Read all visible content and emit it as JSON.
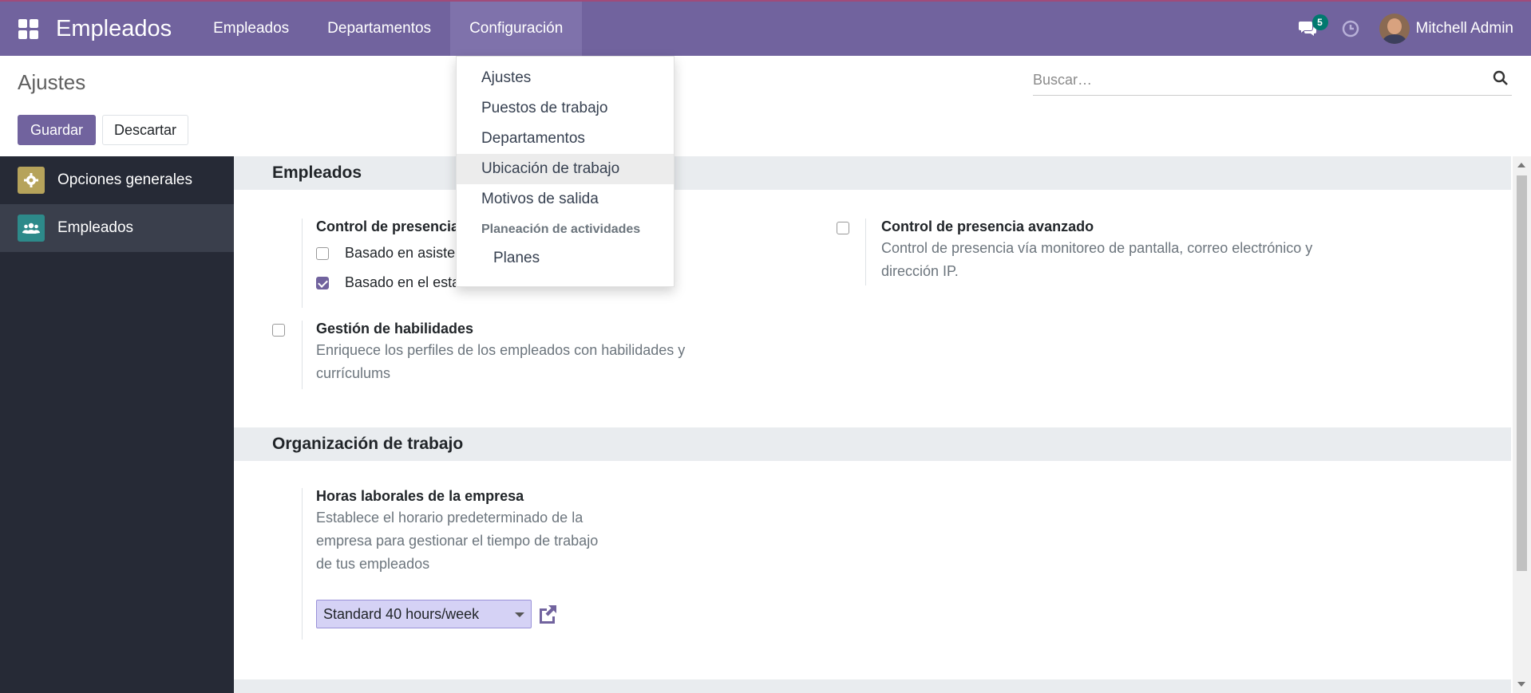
{
  "app": {
    "brand": "Empleados",
    "menu": [
      "Empleados",
      "Departamentos",
      "Configuración"
    ],
    "active_menu": "Configuración",
    "chat_badge": "5",
    "user": "Mitchell Admin"
  },
  "control": {
    "title": "Ajustes",
    "save_label": "Guardar",
    "discard_label": "Descartar",
    "search_placeholder": "Buscar…"
  },
  "sidebar": {
    "items": [
      {
        "label": "Opciones generales",
        "icon": "gear-icon"
      },
      {
        "label": "Empleados",
        "icon": "users-icon"
      }
    ]
  },
  "sections": {
    "employees": {
      "title": "Empleados",
      "presence": {
        "title": "Control de presencia",
        "options": [
          {
            "label": "Basado en asistencias",
            "checked": false
          },
          {
            "label": "Basado en el estado del usuario en el sistema",
            "checked": true
          }
        ]
      },
      "advanced": {
        "title": "Control de presencia avanzado",
        "desc1": "Control de presencia vía monitoreo de pantalla, correo electrónico y",
        "desc2": "dirección IP."
      },
      "skills": {
        "title": "Gestión de habilidades",
        "desc1": "Enriquece los perfiles de los empleados con habilidades y",
        "desc2": "currículums"
      }
    },
    "work_org": {
      "title": "Organización de trabajo",
      "hours": {
        "title": "Horas laborales de la empresa",
        "desc1": "Establece el horario predeterminado de la",
        "desc2": "empresa para gestionar el tiempo de trabajo",
        "desc3": "de tus empleados",
        "value": "Standard 40 hours/week"
      }
    }
  },
  "dropdown": {
    "items": [
      "Ajustes",
      "Puestos de trabajo",
      "Departamentos",
      "Ubicación de trabajo",
      "Motivos de salida"
    ],
    "hovered": "Ubicación de trabajo",
    "header": "Planeación de actividades",
    "sub_items": [
      "Planes"
    ]
  },
  "colors": {
    "navbar": "#71639e",
    "accent": "#71639e",
    "sidebar": "#262a36",
    "badge": "#01796f"
  }
}
